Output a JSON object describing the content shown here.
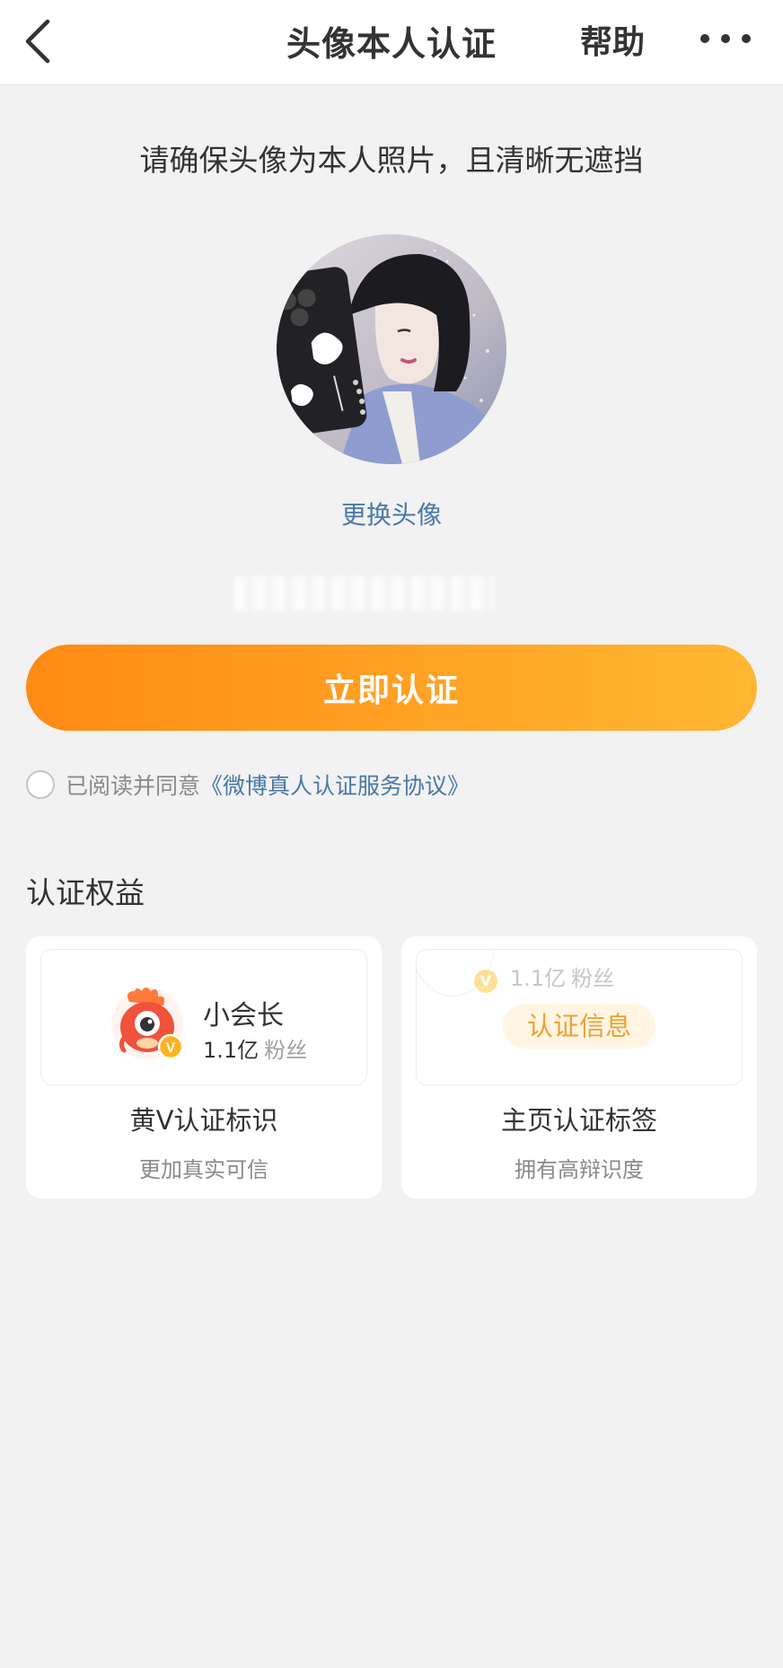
{
  "nav": {
    "title": "头像本人认证",
    "help": "帮助",
    "back_icon": "chevron-left-icon",
    "more_icon": "more-horizontal-icon"
  },
  "hint": "请确保头像为本人照片，且清晰无遮挡",
  "change_avatar": "更换头像",
  "cta_label": "立即认证",
  "agreement": {
    "prefix": "已阅读并同意",
    "link": "《微博真人认证服务协议》"
  },
  "benefits": {
    "title": "认证权益",
    "cards": [
      {
        "preview_name": "小会长",
        "preview_fans_count": "1.1亿",
        "preview_fans_label": "粉丝",
        "badge_letter": "V",
        "label": "黄V认证标识",
        "sub": "更加真实可信"
      },
      {
        "preview_fans_count": "1.1亿",
        "preview_fans_label": "粉丝",
        "badge_letter": "V",
        "tag": "认证信息",
        "label": "主页认证标签",
        "sub": "拥有高辩识度"
      }
    ]
  },
  "colors": {
    "accent_start": "#ff8a14",
    "accent_end": "#ffb733",
    "link": "#4a78a8",
    "badge": "#ffb21e",
    "background": "#f2f2f2"
  }
}
